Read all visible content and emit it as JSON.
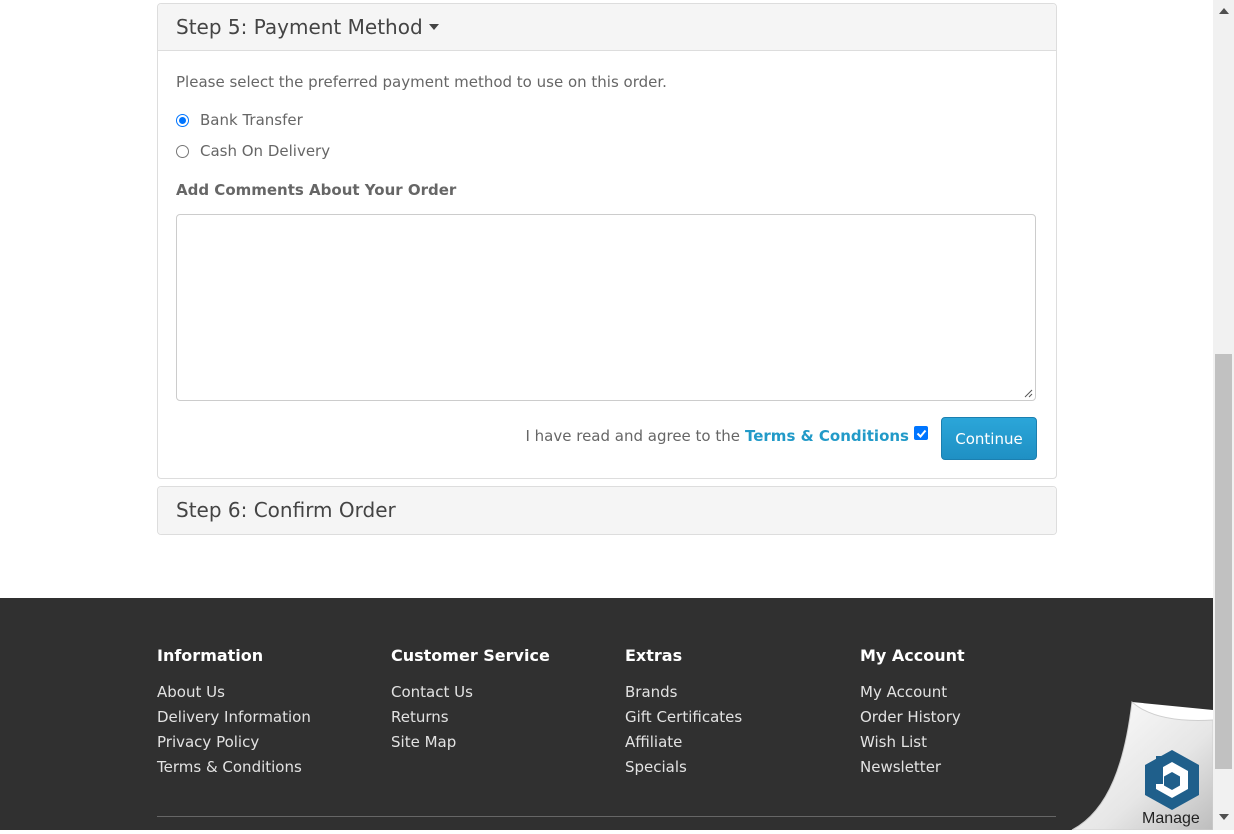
{
  "step5": {
    "title": "Step 5: Payment Method",
    "instruction": "Please select the preferred payment method to use on this order.",
    "payment_options": [
      {
        "label": "Bank Transfer",
        "selected": true
      },
      {
        "label": "Cash On Delivery",
        "selected": false
      }
    ],
    "comments_label": "Add Comments About Your Order",
    "comments_value": "",
    "agree_text": "I have read and agree to the",
    "terms_link": "Terms & Conditions",
    "agree_checked": true,
    "continue_label": "Continue"
  },
  "step6": {
    "title": "Step 6: Confirm Order"
  },
  "footer": {
    "columns": [
      {
        "heading": "Information",
        "links": [
          "About Us",
          "Delivery Information",
          "Privacy Policy",
          "Terms & Conditions"
        ]
      },
      {
        "heading": "Customer Service",
        "links": [
          "Contact Us",
          "Returns",
          "Site Map"
        ]
      },
      {
        "heading": "Extras",
        "links": [
          "Brands",
          "Gift Certificates",
          "Affiliate",
          "Specials"
        ]
      },
      {
        "heading": "My Account",
        "links": [
          "My Account",
          "Order History",
          "Wish List",
          "Newsletter"
        ]
      }
    ]
  },
  "manage_widget": {
    "label": "Manage"
  },
  "colors": {
    "link": "#229ac8",
    "button": "#229ac8",
    "footer_bg": "#303030",
    "radio_checked": "#0075ff"
  }
}
